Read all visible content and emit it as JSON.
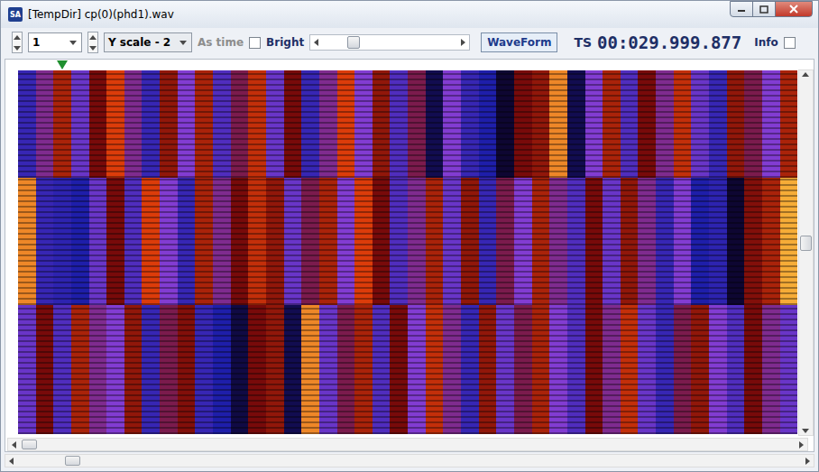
{
  "window": {
    "title": "[TempDir] cp(0)(phd1).wav",
    "app_icon": "SA"
  },
  "toolbar": {
    "channel": "1",
    "y_scale": "Y scale - 2",
    "as_time": {
      "label": "As time",
      "disabled": true
    },
    "bright": {
      "label": "Bright",
      "checked": false
    },
    "slider": {
      "level": 0.2
    },
    "waveform_button": "WaveForm",
    "ts_label": "TS",
    "timestamp": "00:029.999.877",
    "info": {
      "label": "Info",
      "checked": false
    }
  },
  "marker": {
    "level": 0.05
  },
  "spectrogram": {
    "bands": [
      {
        "values": [
          0.3,
          0.5,
          0.7,
          0.4,
          0.6,
          0.8,
          0.5,
          0.3,
          0.65,
          0.45,
          0.7,
          0.35,
          0.55,
          0.75,
          0.4,
          0.6,
          0.3,
          0.5,
          0.8,
          0.45,
          0.65,
          0.35,
          0.55,
          0.1,
          0.45,
          0.3,
          0.25,
          0.05,
          0.6,
          0.65,
          0.9,
          0.1,
          0.45,
          0.7,
          0.35,
          0.6,
          0.5,
          0.75,
          0.4,
          0.3,
          0.65,
          0.55,
          0.45,
          0.7
        ]
      },
      {
        "values": [
          0.9,
          0.3,
          0.28,
          0.25,
          0.4,
          0.6,
          0.35,
          0.8,
          0.45,
          0.3,
          0.7,
          0.5,
          0.6,
          0.75,
          0.65,
          0.4,
          0.55,
          0.7,
          0.45,
          0.8,
          0.6,
          0.35,
          0.5,
          0.7,
          0.4,
          0.65,
          0.3,
          0.55,
          0.45,
          0.7,
          0.5,
          0.35,
          0.6,
          0.4,
          0.65,
          0.5,
          0.3,
          0.45,
          0.25,
          0.28,
          0.05,
          0.62,
          0.7,
          0.95
        ]
      },
      {
        "values": [
          0.4,
          0.6,
          0.35,
          0.7,
          0.5,
          0.45,
          0.65,
          0.3,
          0.55,
          0.62,
          0.3,
          0.25,
          0.08,
          0.6,
          0.65,
          0.1,
          0.9,
          0.4,
          0.55,
          0.7,
          0.35,
          0.6,
          0.45,
          0.75,
          0.5,
          0.3,
          0.65,
          0.4,
          0.55,
          0.7,
          0.45,
          0.35,
          0.6,
          0.5,
          0.75,
          0.4,
          0.3,
          0.55,
          0.65,
          0.45,
          0.35,
          0.6,
          0.5,
          0.4
        ]
      }
    ]
  },
  "scrollbars": {
    "vertical": {
      "level": 0.47
    },
    "inner_horizontal": {
      "level": 0.0
    },
    "outer_horizontal": {
      "level": 0.06
    }
  }
}
